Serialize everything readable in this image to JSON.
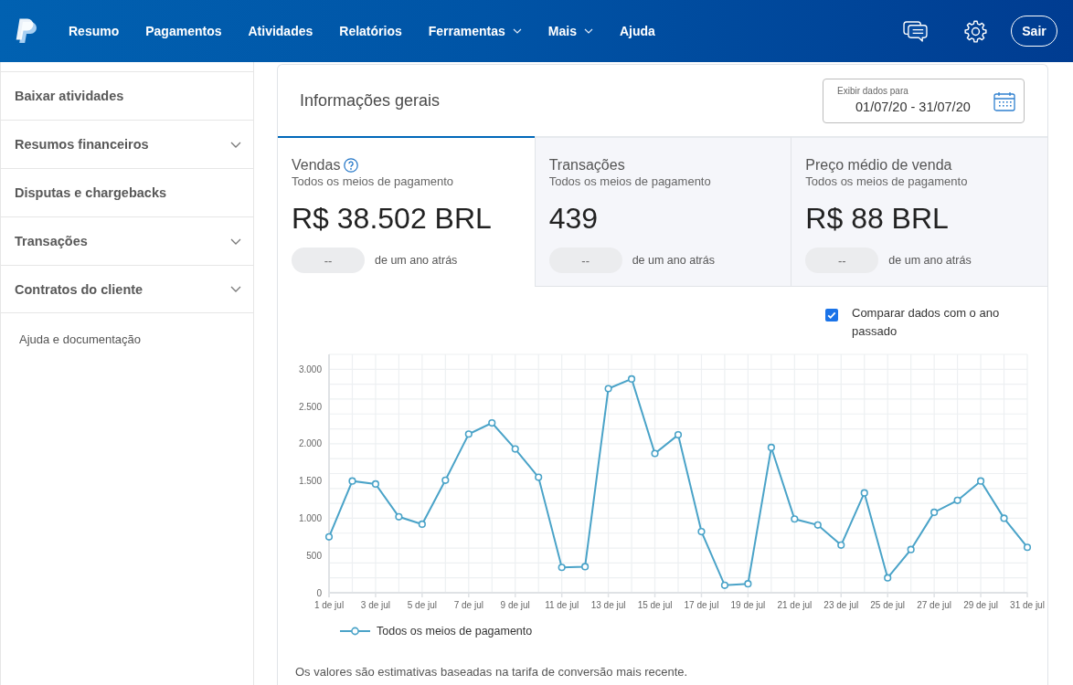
{
  "nav": {
    "items": [
      {
        "label": "Resumo",
        "has_menu": false
      },
      {
        "label": "Pagamentos",
        "has_menu": false
      },
      {
        "label": "Atividades",
        "has_menu": false
      },
      {
        "label": "Relatórios",
        "has_menu": false
      },
      {
        "label": "Ferramentas",
        "has_menu": true
      },
      {
        "label": "Mais",
        "has_menu": true
      },
      {
        "label": "Ajuda",
        "has_menu": false
      }
    ],
    "logout": "Sair"
  },
  "sidebar": {
    "items": [
      {
        "label": "Baixar atividades",
        "expandable": false
      },
      {
        "label": "Resumos financeiros",
        "expandable": true
      },
      {
        "label": "Disputas e chargebacks",
        "expandable": false
      },
      {
        "label": "Transações",
        "expandable": true
      },
      {
        "label": "Contratos do cliente",
        "expandable": true
      }
    ],
    "help_link": "Ajuda e documentação"
  },
  "overview": {
    "title": "Informações gerais",
    "date_filter": {
      "label": "Exibir dados para",
      "value": "01/07/20 - 31/07/20"
    },
    "metrics": [
      {
        "title": "Vendas",
        "help": true,
        "subtitle": "Todos os meios de pagamento",
        "value": "R$ 38.502 BRL",
        "change": "--",
        "change_label": "de um ano atrás",
        "selected": true
      },
      {
        "title": "Transações",
        "help": false,
        "subtitle": "Todos os meios de pagamento",
        "value": "439",
        "change": "--",
        "change_label": "de um ano atrás",
        "selected": false
      },
      {
        "title": "Preço médio de venda",
        "help": false,
        "subtitle": "Todos os meios de pagamento",
        "value": "R$ 88 BRL",
        "change": "--",
        "change_label": "de um ano atrás",
        "selected": false
      }
    ],
    "compare": {
      "label": "Comparar dados com o ano passado",
      "checked": true
    },
    "chart_data": {
      "type": "line",
      "grid": true,
      "categories": [
        "1 de jul",
        null,
        "3 de jul",
        null,
        "5 de jul",
        null,
        "7 de jul",
        null,
        "9 de jul",
        null,
        "11 de jul",
        null,
        "13 de jul",
        null,
        "15 de jul",
        null,
        "17 de jul",
        null,
        "19 de jul",
        null,
        "21 de jul",
        null,
        "23 de jul",
        null,
        "25 de jul",
        null,
        "27 de jul",
        null,
        "29 de jul",
        null,
        "31 de jul"
      ],
      "ylim": [
        0,
        3200
      ],
      "yticks": [
        {
          "value": 0,
          "label": "0"
        },
        {
          "value": 500,
          "label": "500"
        },
        {
          "value": 1000,
          "label": "1.000"
        },
        {
          "value": 1500,
          "label": "1.500"
        },
        {
          "value": 2000,
          "label": "2.000"
        },
        {
          "value": 2500,
          "label": "2.500"
        },
        {
          "value": 3000,
          "label": "3.000"
        }
      ],
      "series": [
        {
          "name": "Todos os meios de pagamento",
          "color": "#4aa3c8",
          "marker": "circle",
          "values": [
            750,
            1500,
            1460,
            1020,
            920,
            1510,
            2130,
            2280,
            1930,
            1550,
            340,
            350,
            2740,
            2870,
            1870,
            2120,
            820,
            100,
            120,
            1950,
            990,
            910,
            640,
            1340,
            200,
            580,
            1080,
            1240,
            1500,
            1000,
            610
          ]
        }
      ]
    },
    "note": "Os valores são estimativas baseadas na tarifa de conversão mais recente."
  }
}
